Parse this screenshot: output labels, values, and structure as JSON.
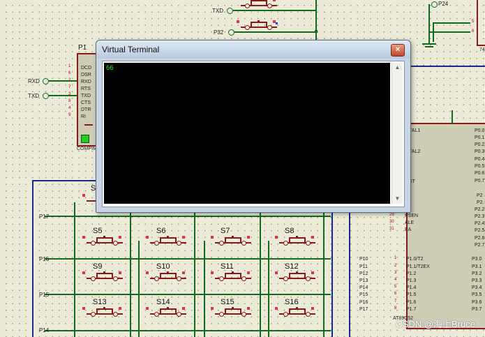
{
  "window": {
    "title": "Virtual Terminal",
    "close_glyph": "×",
    "terminal_output": "66",
    "scroll_up_glyph": "▲",
    "scroll_down_glyph": "▼"
  },
  "schematic": {
    "top_nets": [
      "TXD",
      "P32",
      "P24"
    ],
    "left_nets": [
      "RXD",
      "TXD"
    ],
    "p1": {
      "name": "P1",
      "label": "COMPIM",
      "pins": [
        "DCD",
        "DSR",
        "RXD",
        "RTS",
        "TXD",
        "CTS",
        "DTR",
        "RI"
      ],
      "pin_numbers": [
        "1",
        "6",
        "2",
        "7",
        "3",
        "8",
        "4",
        "9"
      ]
    },
    "switches": [
      "S5",
      "S6",
      "S7",
      "S8",
      "S9",
      "S10",
      "S11",
      "S12",
      "S13",
      "S14",
      "S15",
      "S16"
    ],
    "partial_switch": "S",
    "row_nets": [
      "P17",
      "P16",
      "P15",
      "P14"
    ],
    "mcu": {
      "name": "AT89C52",
      "left_pins_top": [
        "TAL1",
        "TAL2",
        "ST"
      ],
      "control_pins": [
        "PSEN",
        "ALE",
        "EA"
      ],
      "control_pin_numbers": [
        "29",
        "30",
        "31"
      ],
      "port1_pins": [
        "P1.0/T2",
        "P1.1/T2EX",
        "P1.2",
        "P1.3",
        "P1.4",
        "P1.5",
        "P1.6",
        "P1.7"
      ],
      "port1_pin_numbers": [
        "1",
        "2",
        "3",
        "4",
        "5",
        "6",
        "7",
        "8"
      ],
      "port1_nets": [
        "P10",
        "P11",
        "P12",
        "P13",
        "P14",
        "P15",
        "P16",
        "P17"
      ],
      "right_pins_p0": [
        "P0.0",
        "P0.1",
        "P0.2",
        "P0.3",
        "P0.4",
        "P0.5",
        "P0.6",
        "P0.7"
      ],
      "right_pins_p2": [
        "P2",
        "P2.",
        "P2.2",
        "P2.3",
        "P2.4",
        "P2.5",
        "P2.6",
        "P2.7"
      ],
      "right_pins_p3": [
        "P3.0",
        "P3.1",
        "P3.2",
        "P3.3",
        "P3.4",
        "P3.5",
        "P3.6",
        "P3.7"
      ]
    },
    "right_top_pins": [
      "5",
      "6",
      "74"
    ]
  },
  "watermark": "CSDN @海上Bruce"
}
